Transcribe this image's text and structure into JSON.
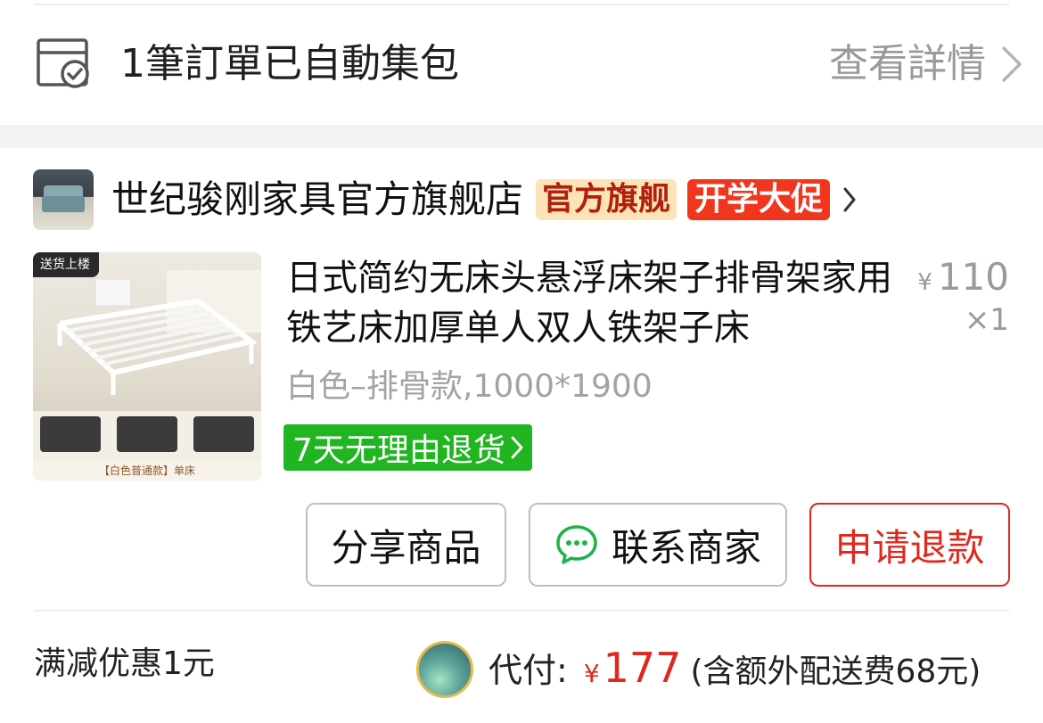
{
  "package": {
    "icon": "package-check-icon",
    "text": "1筆訂單已自動集包",
    "detail_link": "查看詳情"
  },
  "store": {
    "name": "世纪骏刚家具官方旗舰店",
    "badge_official": "官方旗舰",
    "badge_promo": "开学大促"
  },
  "product": {
    "thumb_tag": "送货上楼",
    "thumb_caption": "【白色普通款】单床",
    "title": "日式简约无床头悬浮床架子排骨架家用铁艺床加厚单人双人铁架子床",
    "price_symbol": "¥",
    "price": "110",
    "quantity": "×1",
    "spec": "白色–排骨款,1000*1900",
    "return_policy": "7天无理由退货"
  },
  "actions": {
    "share": "分享商品",
    "contact": "联系商家",
    "refund": "申请退款"
  },
  "summary": {
    "discount": "满减优惠1元",
    "pay_label": "代付:",
    "pay_symbol": "¥",
    "pay_amount": "177",
    "pay_note": "(含额外配送费68元)"
  },
  "colors": {
    "accent_red": "#e0281e",
    "return_green": "#21b521",
    "badge_official_bg": "#fde3b8",
    "badge_promo_bg": "#f2361e"
  }
}
